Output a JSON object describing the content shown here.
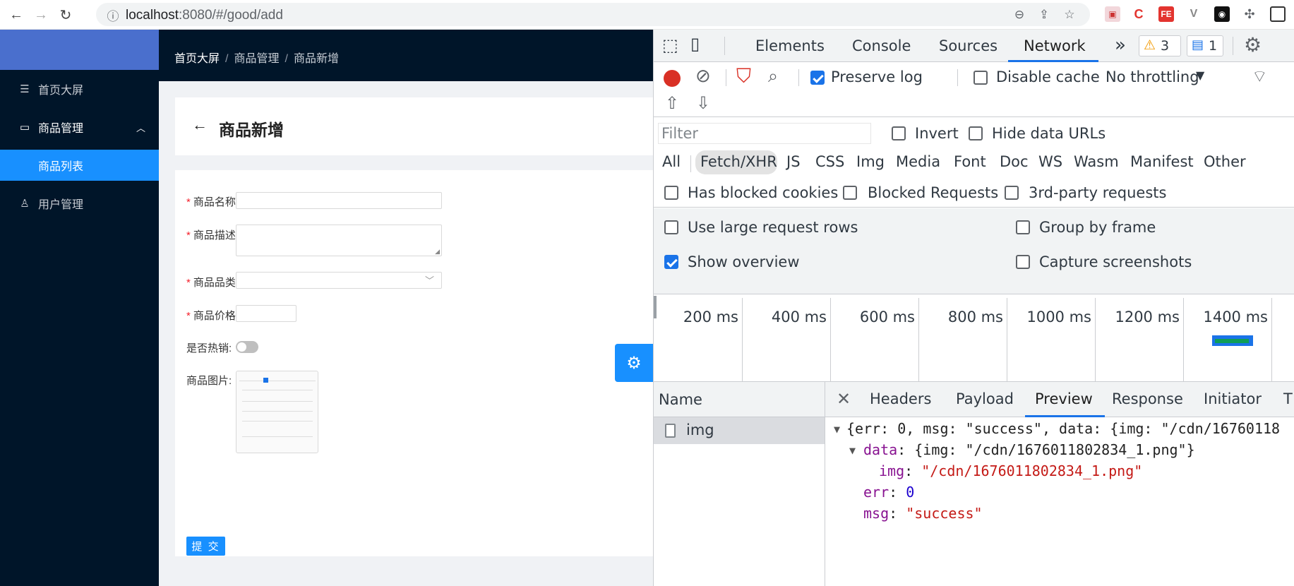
{
  "browser": {
    "url_host": "localhost",
    "url_path": ":8080/#/good/add"
  },
  "sidebar": {
    "items": [
      {
        "label": "首页大屏"
      },
      {
        "label": "商品管理"
      },
      {
        "label": "商品列表"
      },
      {
        "label": "用户管理"
      }
    ]
  },
  "breadcrumb": [
    "首页大屏",
    "商品管理",
    "商品新增"
  ],
  "breadcrumb_sep": "/",
  "page": {
    "title": "商品新增"
  },
  "form": {
    "fields": [
      {
        "label": "商品名称",
        "required": "*"
      },
      {
        "label": "商品描述",
        "required": "*"
      },
      {
        "label": "商品品类",
        "required": "*"
      },
      {
        "label": "商品价格",
        "required": "*"
      },
      {
        "label": "是否热销:"
      },
      {
        "label": "商品图片:"
      }
    ],
    "submit_label": "提 交",
    "hot_switch_on": false
  },
  "devtools": {
    "tabs": [
      "Elements",
      "Console",
      "Sources",
      "Network"
    ],
    "active_tab": "Network",
    "more_tabs": "»",
    "warnings_count": "3",
    "messages_count": "1",
    "toolbar": {
      "preserve_log": "Preserve log",
      "disable_cache": "Disable cache",
      "throttling": "No throttling"
    },
    "filter": {
      "placeholder": "Filter",
      "invert": "Invert",
      "hide_data_urls": "Hide data URLs",
      "types": [
        "All",
        "Fetch/XHR",
        "JS",
        "CSS",
        "Img",
        "Media",
        "Font",
        "Doc",
        "WS",
        "Wasm",
        "Manifest",
        "Other"
      ],
      "active_type": "Fetch/XHR",
      "has_blocked_cookies": "Has blocked cookies",
      "blocked_requests": "Blocked Requests",
      "third_party": "3rd-party requests"
    },
    "settings": {
      "large_rows": "Use large request rows",
      "group_by_frame": "Group by frame",
      "show_overview": "Show overview",
      "capture_screenshots": "Capture screenshots"
    },
    "timeline_ticks": [
      "200 ms",
      "400 ms",
      "600 ms",
      "800 ms",
      "1000 ms",
      "1200 ms",
      "1400 ms"
    ],
    "name_header": "Name",
    "requests": [
      {
        "name": "img"
      }
    ],
    "detail_tabs": [
      "Headers",
      "Payload",
      "Preview",
      "Response",
      "Initiator",
      "T"
    ],
    "active_detail_tab": "Preview",
    "preview": {
      "line1": "{err: 0, msg: \"success\", data: {img: \"/cdn/16760118",
      "data_key": "data",
      "data_val": "{img: \"/cdn/1676011802834_1.png\"}",
      "img_key": "img",
      "img_val": "\"/cdn/1676011802834_1.png\"",
      "err_key": "err",
      "err_val": "0",
      "msg_key": "msg",
      "msg_val": "\"success\""
    }
  },
  "colors": {
    "sidebar_bg": "#001529",
    "primary": "#1890ff",
    "devtools_accent": "#1a73e8",
    "record_red": "#d93025"
  }
}
